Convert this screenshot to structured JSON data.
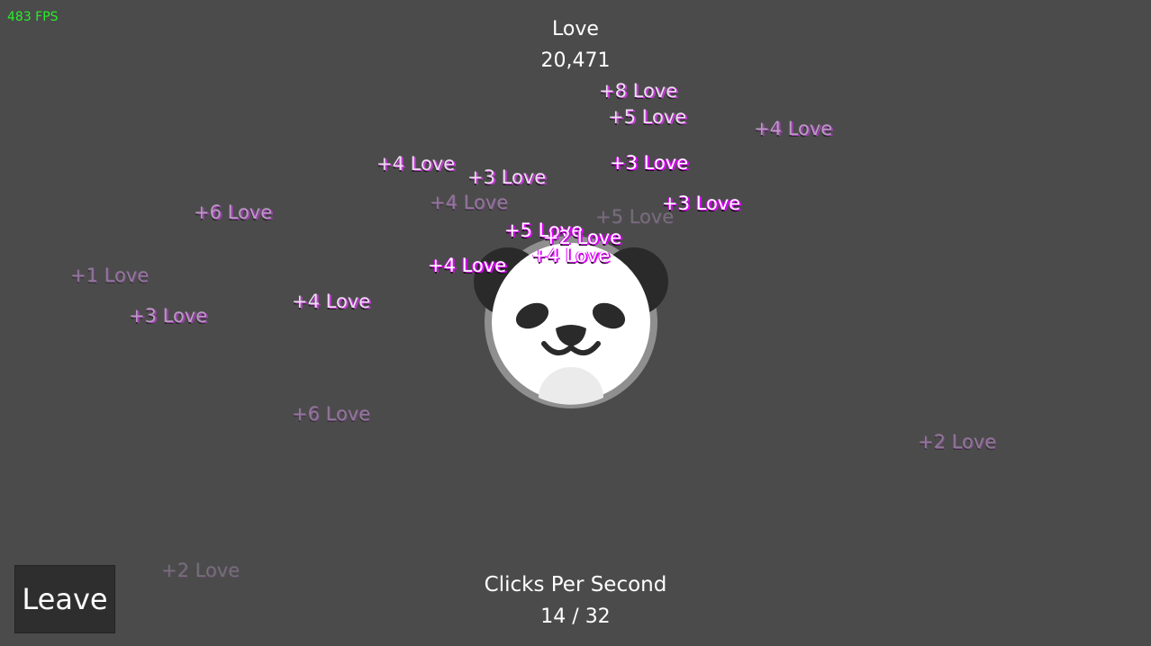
{
  "hud": {
    "fps": "483 FPS",
    "love_label": "Love",
    "love_count": "20,471",
    "cps_label": "Clicks Per Second",
    "cps_value": "14 / 32"
  },
  "leave_button": {
    "label": "Leave"
  },
  "floaters": [
    {
      "text": "+8 Love"
    },
    {
      "text": "+5 Love"
    },
    {
      "text": "+4 Love"
    },
    {
      "text": "+4 Love"
    },
    {
      "text": "+3 Love"
    },
    {
      "text": "+3 Love"
    },
    {
      "text": "+6 Love"
    },
    {
      "text": "+4 Love"
    },
    {
      "text": "+3 Love"
    },
    {
      "text": "+5 Love"
    },
    {
      "text": "+5 Love"
    },
    {
      "text": "+2 Love"
    },
    {
      "text": "+4 Love"
    },
    {
      "text": "+4 Love"
    },
    {
      "text": "+1 Love"
    },
    {
      "text": "+4 Love"
    },
    {
      "text": "+3 Love"
    },
    {
      "text": "+6 Love"
    },
    {
      "text": "+2 Love"
    },
    {
      "text": "+2 Love"
    }
  ],
  "colors": {
    "background": "#4b4b4b",
    "fps_text": "#27f02a",
    "floater_glow": "#e000ff",
    "button_bg": "#2e2e2e"
  },
  "icons": {
    "panda": "panda-face-icon"
  }
}
